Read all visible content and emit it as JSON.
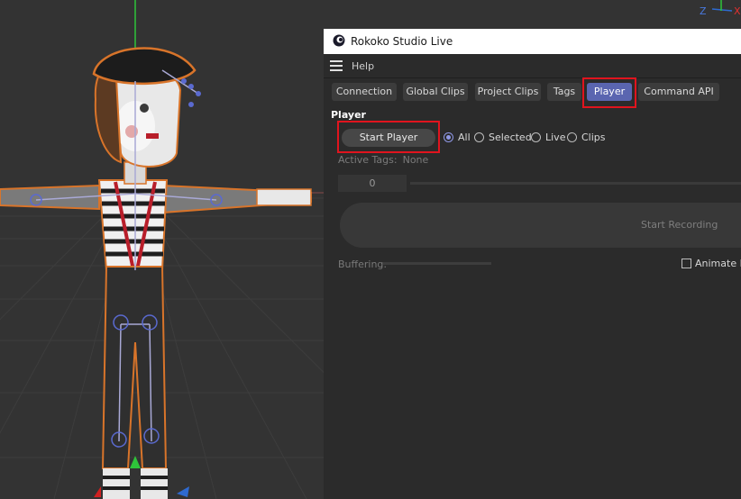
{
  "window": {
    "title": "Rokoko Studio Live"
  },
  "menu": {
    "help": "Help"
  },
  "tabs": [
    {
      "label": "Connection"
    },
    {
      "label": "Global Clips"
    },
    {
      "label": "Project Clips"
    },
    {
      "label": "Tags"
    },
    {
      "label": "Player",
      "active": true
    },
    {
      "label": "Command API"
    }
  ],
  "player": {
    "section_title": "Player",
    "start_button": "Start Player",
    "filters": [
      {
        "label": "All",
        "selected": true
      },
      {
        "label": "Selected",
        "selected": false
      },
      {
        "label": "Live",
        "selected": false
      },
      {
        "label": "Clips",
        "selected": false
      }
    ],
    "active_tags_label": "Active Tags:",
    "active_tags_value": "None",
    "frame_value": "0",
    "record_button": "Start Recording",
    "buffering_label": "Buffering:",
    "animate_label": "Animate D",
    "animate_checked": false
  },
  "viewport": {
    "axis_z": "Z",
    "axis_x": "X"
  },
  "colors": {
    "accent": "#5a65b0",
    "highlight": "#e0141e",
    "panel_bg": "#2b2b2b",
    "viewport_bg": "#333333"
  }
}
